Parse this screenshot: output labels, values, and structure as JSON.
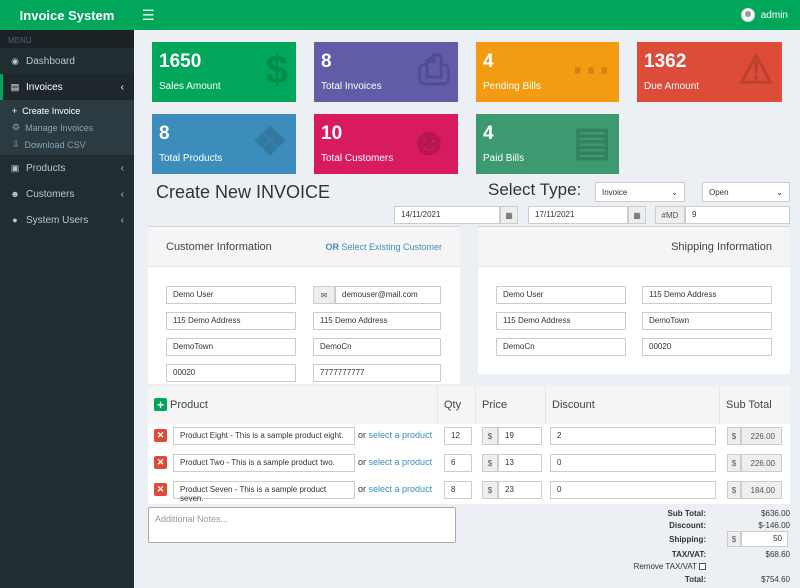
{
  "app": {
    "title": "Invoice System",
    "menu_icon": "hamburger-icon",
    "user": "admin"
  },
  "sidebar": {
    "header": "MENU",
    "items": [
      {
        "label": "Dashboard",
        "icon": "dashboard-icon"
      },
      {
        "label": "Invoices",
        "icon": "file-icon"
      },
      {
        "label": "Products",
        "icon": "box-icon"
      },
      {
        "label": "Customers",
        "icon": "users-icon"
      },
      {
        "label": "System Users",
        "icon": "user-icon"
      }
    ],
    "subitems": [
      {
        "label": "Create Invoice"
      },
      {
        "label": "Manage Invoices"
      },
      {
        "label": "Download CSV"
      }
    ]
  },
  "stats": [
    {
      "value": "1650",
      "label": "Sales Amount",
      "color": "#00a65a"
    },
    {
      "value": "8",
      "label": "Total Invoices",
      "color": "#605ca8"
    },
    {
      "value": "4",
      "label": "Pending Bills",
      "color": "#f39c12"
    },
    {
      "value": "1362",
      "label": "Due Amount",
      "color": "#dd4b39"
    },
    {
      "value": "8",
      "label": "Total Products",
      "color": "#3c8dbc"
    },
    {
      "value": "10",
      "label": "Total Customers",
      "color": "#d81b60"
    },
    {
      "value": "4",
      "label": "Paid Bills",
      "color": "#3d9970"
    }
  ],
  "form": {
    "title": "Create New INVOICE",
    "select_type_label": "Select Type:",
    "type_value": "Invoice",
    "status_value": "Open",
    "date_invoice": "14/11/2021",
    "date_due": "17/11/2021",
    "invoice_prefix": "#MD",
    "invoice_number": "9"
  },
  "customer": {
    "title": "Customer Information",
    "or": "OR",
    "existing": "Select Existing Customer",
    "name": "Demo User",
    "email": "demouser@mail.com",
    "address1": "115 Demo Address",
    "address2": "115 Demo Address",
    "town": "DemoTown",
    "country": "DemoCn",
    "postcode": "00020",
    "phone": "7777777777"
  },
  "shipping": {
    "title": "Shipping Information",
    "name": "Demo User",
    "address1": "115 Demo Address",
    "address2": "115 Demo Address",
    "town": "DemoTown",
    "country": "DemoCn",
    "postcode": "00020"
  },
  "table": {
    "headers": {
      "product": "Product",
      "qty": "Qty",
      "price": "Price",
      "discount": "Discount",
      "subtotal": "Sub Total"
    },
    "currency": "$",
    "or_text": "or",
    "select_text": "select a product",
    "rows": [
      {
        "product": "Product Eight - This is a sample product eight.",
        "qty": "12",
        "price": "19",
        "discount": "2",
        "subtotal": "226.00"
      },
      {
        "product": "Product Two - This is a sample product two.",
        "qty": "6",
        "price": "13",
        "discount": "0",
        "subtotal": "226.00"
      },
      {
        "product": "Product Seven - This is a sample product seven.",
        "qty": "8",
        "price": "23",
        "discount": "0",
        "subtotal": "184.00"
      }
    ]
  },
  "notes_placeholder": "Additional Notes...",
  "totals": {
    "subtotal_label": "Sub Total:",
    "subtotal": "$636.00",
    "discount_label": "Discount:",
    "discount": "$-146.00",
    "shipping_label": "Shipping:",
    "shipping_currency": "$",
    "shipping": "50",
    "tax_label": "TAX/VAT:",
    "tax": "$68.60",
    "remove_tax_label": "Remove TAX/VAT",
    "total_label": "Total:",
    "total": "$754.60"
  }
}
